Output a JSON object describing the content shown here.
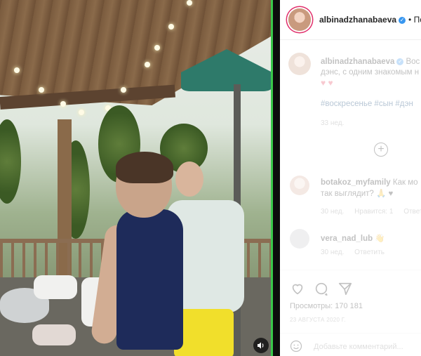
{
  "video": {
    "sound_icon": "speaker-icon"
  },
  "header": {
    "username": "albinadzhanabaeva",
    "separator": "• По"
  },
  "caption": {
    "username": "albinadzhanabaeva",
    "text_start": "Вос",
    "line2": "дэнс, с одним знакомым н",
    "hearts": "♥ ♥",
    "hashtags": "#воскресенье #сын #дэн",
    "time": "33 нед."
  },
  "comments": [
    {
      "username": "botakoz_myfamily",
      "text_start": "Как мо",
      "line2": "так выглядит? 🙏 ♥",
      "time": "30 нед.",
      "likes": "Нравится: 1",
      "reply": "Ответи"
    },
    {
      "username": "vera_nad_lub",
      "text_start": "👋",
      "time": "30 нед.",
      "reply": "Ответить"
    }
  ],
  "actions": {
    "like_icon": "heart-icon",
    "comment_icon": "comment-icon",
    "share_icon": "share-icon"
  },
  "views": "Просмотры: 170 181",
  "date": "23 АВГУСТА 2020 Г.",
  "add_comment_placeholder": "Добавьте комментарий...",
  "colors": {
    "verified": "#3897f0",
    "story_ring": "#e1306c",
    "link": "#00376b",
    "muted": "#8e8e8e"
  }
}
